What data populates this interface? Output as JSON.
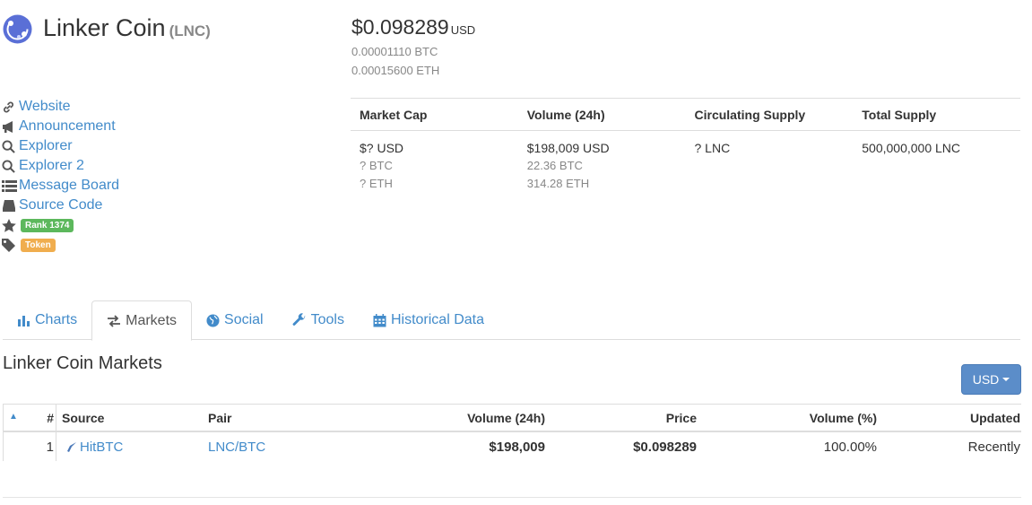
{
  "coin": {
    "name": "Linker Coin",
    "symbol": "(LNC)"
  },
  "price": {
    "usd": "$0.098289",
    "usd_unit": "USD",
    "btc": "0.00001110 BTC",
    "eth": "0.00015600 ETH"
  },
  "links": [
    {
      "icon": "link-icon",
      "label": "Website"
    },
    {
      "icon": "bullhorn-icon",
      "label": "Announcement"
    },
    {
      "icon": "search-icon",
      "label": "Explorer"
    },
    {
      "icon": "search-icon",
      "label": "Explorer 2"
    },
    {
      "icon": "list-icon",
      "label": "Message Board"
    },
    {
      "icon": "hdd-icon",
      "label": "Source Code"
    }
  ],
  "badges": {
    "rank": "Rank 1374",
    "type": "Token"
  },
  "stats": {
    "headers": [
      "Market Cap",
      "Volume (24h)",
      "Circulating Supply",
      "Total Supply"
    ],
    "market_cap": {
      "usd": "$? USD",
      "btc": "? BTC",
      "eth": "? ETH"
    },
    "volume": {
      "usd": "$198,009 USD",
      "btc": "22.36 BTC",
      "eth": "314.28 ETH"
    },
    "circulating": "? LNC",
    "total": "500,000,000 LNC"
  },
  "tabs": [
    {
      "label": "Charts",
      "icon": "bar-chart-icon"
    },
    {
      "label": "Markets",
      "icon": "transfer-icon",
      "active": true
    },
    {
      "label": "Social",
      "icon": "globe-icon"
    },
    {
      "label": "Tools",
      "icon": "wrench-icon"
    },
    {
      "label": "Historical Data",
      "icon": "calendar-icon"
    }
  ],
  "markets": {
    "title": "Linker Coin Markets",
    "currency_button": "USD",
    "columns": [
      "#",
      "Source",
      "Pair",
      "Volume (24h)",
      "Price",
      "Volume (%)",
      "Updated"
    ],
    "rows": [
      {
        "num": "1",
        "source": "HitBTC",
        "pair": "LNC/BTC",
        "volume": "$198,009",
        "price": "$0.098289",
        "volume_pct": "100.00%",
        "updated": "Recently"
      }
    ]
  },
  "colors": {
    "link": "#428bca",
    "rank_badge": "#5cb85c",
    "token_badge": "#f0ad4e",
    "button": "#5b8dc9"
  }
}
